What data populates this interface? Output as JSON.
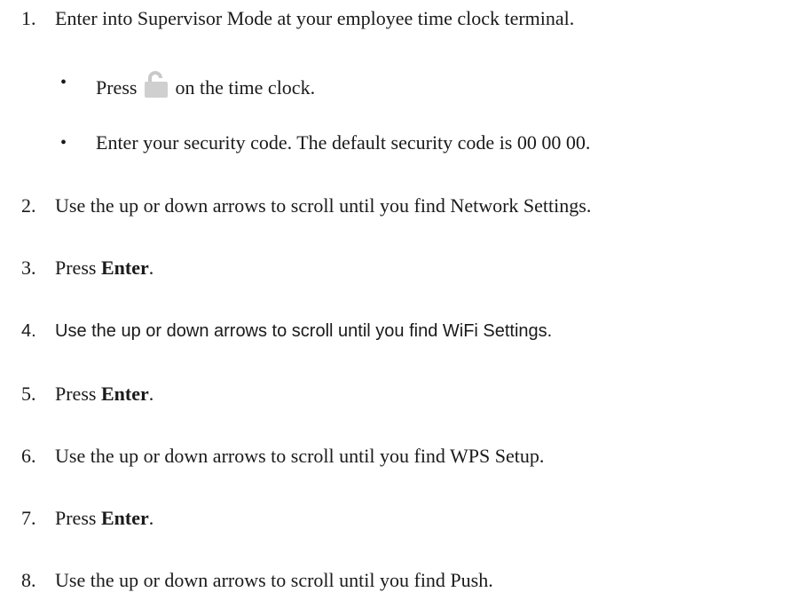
{
  "steps": [
    {
      "number": "1.",
      "text": "Enter into Supervisor Mode at your employee time clock terminal."
    },
    {
      "number": "2.",
      "text": "Use the up or down arrows to scroll until you find Network Settings."
    },
    {
      "number": "3.",
      "prefix": "Press ",
      "bold": "Enter",
      "suffix": "."
    },
    {
      "number": "4.",
      "text": "Use the up or down arrows to scroll until you find WiFi Settings."
    },
    {
      "number": "5.",
      "prefix": "Press ",
      "bold": "Enter",
      "suffix": "."
    },
    {
      "number": "6.",
      "text": "Use the up or down arrows to scroll until you find WPS Setup."
    },
    {
      "number": "7.",
      "prefix": "Press ",
      "bold": "Enter",
      "suffix": "."
    },
    {
      "number": "8.",
      "text": "Use the up or down arrows to scroll until you find Push."
    }
  ],
  "substeps": [
    {
      "bullet": "•",
      "prefix": "Press ",
      "icon": "lock-icon",
      "suffix": " on the time clock."
    },
    {
      "bullet": "•",
      "text": "Enter your security code. The default security code is 00 00 00."
    }
  ]
}
